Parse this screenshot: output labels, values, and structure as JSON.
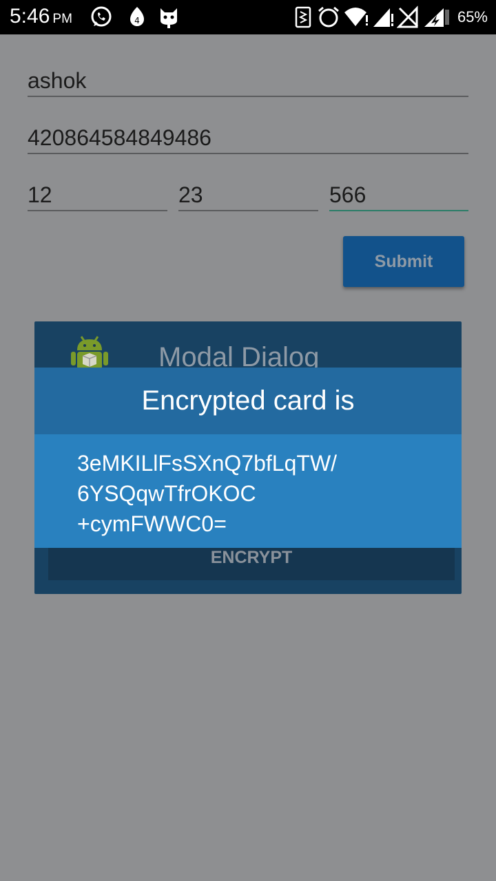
{
  "status_bar": {
    "time": "5:46",
    "ampm": "PM",
    "battery": "65%",
    "icons": [
      "whatsapp-icon",
      "notification-badge-icon",
      "cat-icon",
      "vibrate-icon",
      "alarm-icon",
      "wifi-icon",
      "signal-icon",
      "no-signal-icon",
      "battery-icon"
    ],
    "notification_badge": "4"
  },
  "form": {
    "name_value": "ashok",
    "card_number_value": "420864584849486",
    "month_value": "12",
    "year_value": "23",
    "cvv_value": "566",
    "submit_label": "Submit"
  },
  "background_dialog": {
    "title": "Modal Dialog",
    "encrypt_label": "ENCRYPT"
  },
  "dialog": {
    "title": "Encrypted card is",
    "lines": [
      "3eMKILlFsSXnQ7bfLqTW/",
      "6YSQqwTfrOKOC",
      "+cymFWWC0="
    ]
  },
  "colors": {
    "scrim": "#8e8f91",
    "dialog_header": "#236aa0",
    "dialog_body": "#2981bf",
    "submit_button": "#12528b",
    "active_underline": "#2b7d68"
  }
}
